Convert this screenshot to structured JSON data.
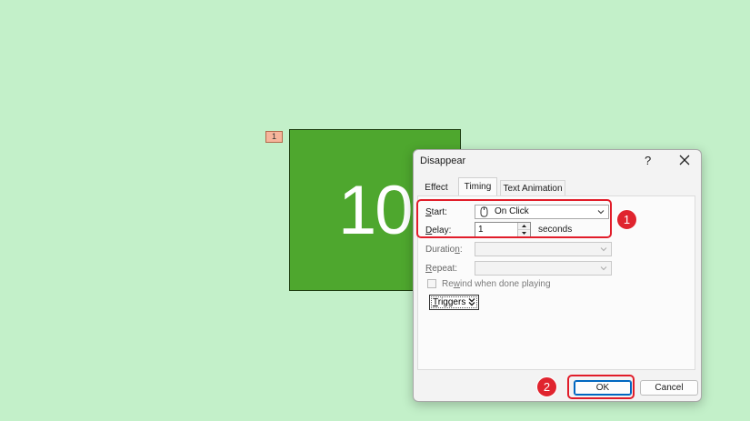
{
  "slide": {
    "animation_tag": "1",
    "shape_text": "10",
    "background_color": "#c3f0c9",
    "shape_color": "#4ea72e"
  },
  "dialog": {
    "title": "Disappear",
    "help": "?",
    "tabs": [
      "Effect",
      "Timing",
      "Text Animation"
    ],
    "active_tab": "Timing",
    "start": {
      "label_accel": "S",
      "label_rest": "tart:",
      "value": "On Click"
    },
    "delay": {
      "label_accel": "D",
      "label_rest": "elay:",
      "value": "1",
      "unit": "seconds"
    },
    "duration": {
      "label_pre": "Duratio",
      "label_accel": "n",
      "label_post": ":",
      "value": ""
    },
    "repeat": {
      "label_accel": "R",
      "label_rest": "epeat:",
      "value": ""
    },
    "rewind": {
      "label_pre": "Re",
      "label_accel": "w",
      "label_post": "ind when done playing",
      "checked": false
    },
    "triggers": {
      "label_accel": "T",
      "label_rest": "riggers"
    },
    "ok_label": "OK",
    "cancel_label": "Cancel"
  },
  "callouts": [
    "1",
    "2"
  ],
  "accent_color": "#e0242e"
}
